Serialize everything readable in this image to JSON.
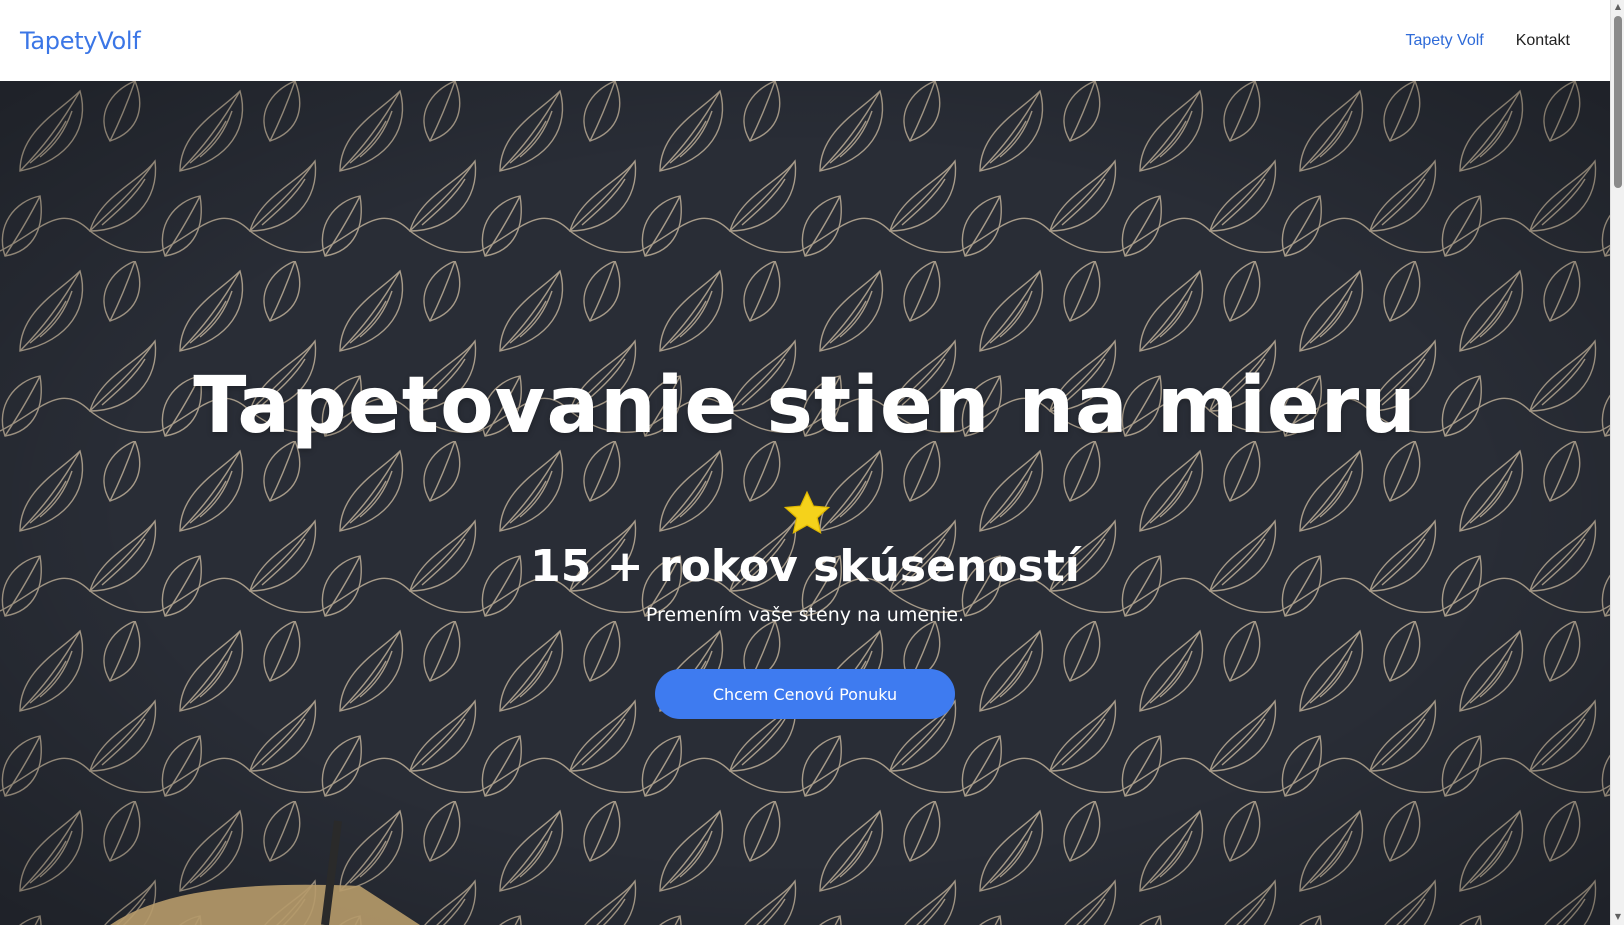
{
  "navbar": {
    "brand": "TapetyVolf",
    "links": [
      {
        "label": "Tapety Volf",
        "active": true
      },
      {
        "label": "Kontakt",
        "active": false
      }
    ]
  },
  "hero": {
    "title": "Tapetovanie stien na mieru",
    "star_icon": "star-icon",
    "subtitle": "15 + rokov skúseností",
    "tagline": "Premením vaše steny na umenie.",
    "cta_label": "Chcem Cenovú Ponuku"
  },
  "colors": {
    "brand": "#3b76e6",
    "cta": "#3e7bf0",
    "hero_background": "#2f343e",
    "pattern_stroke": "#d9c7ad",
    "star": "#f5d21b"
  }
}
